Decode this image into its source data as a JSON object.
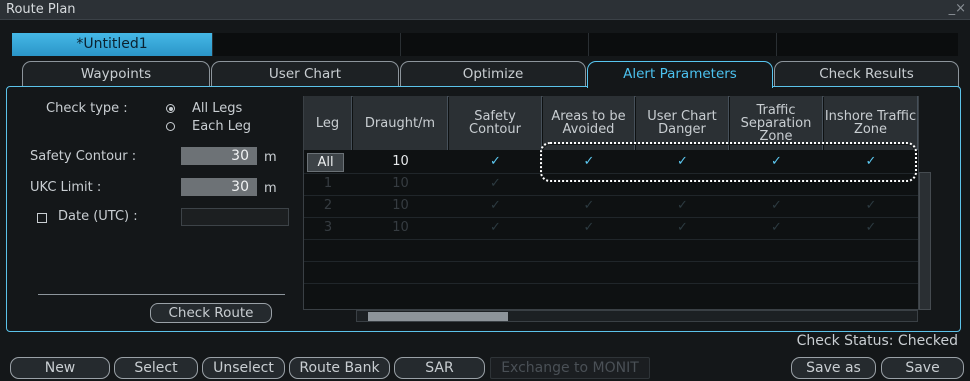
{
  "window": {
    "title": "Route Plan",
    "close": "_×"
  },
  "files": {
    "active": "*Untitled1"
  },
  "tabs": [
    "Waypoints",
    "User Chart",
    "Optimize",
    "Alert Parameters",
    "Check Results"
  ],
  "left": {
    "check_type_label": "Check type :",
    "options": [
      "All Legs",
      "Each Leg"
    ],
    "selected": "All Legs",
    "safety_contour_label": "Safety Contour :",
    "safety_contour_value": "30",
    "safety_contour_unit": "m",
    "ukc_label": "UKC Limit :",
    "ukc_value": "30",
    "ukc_unit": "m",
    "date_label": "Date (UTC) :",
    "check_route": "Check Route"
  },
  "table": {
    "headers": [
      "Leg",
      "Draught/m",
      "Safety Contour",
      "Areas to be Avoided",
      "User Chart Danger",
      "Traffic Separation Zone",
      "Inshore Traffic Zone"
    ],
    "rows": [
      {
        "leg": "All",
        "draught": "10",
        "checks": [
          "✓",
          "✓",
          "✓",
          "✓",
          "✓"
        ]
      },
      {
        "leg": "1",
        "draught": "10",
        "checks": [
          "✓",
          "",
          "",
          "",
          ""
        ]
      },
      {
        "leg": "2",
        "draught": "10",
        "checks": [
          "✓",
          "✓",
          "✓",
          "✓",
          "✓"
        ]
      },
      {
        "leg": "3",
        "draught": "10",
        "checks": [
          "✓",
          "✓",
          "✓",
          "✓",
          "✓"
        ]
      }
    ]
  },
  "status": "Check Status: Checked",
  "footer": {
    "new": "New",
    "select": "Select",
    "unselect": "Unselect",
    "route_bank": "Route Bank",
    "sar": "SAR",
    "exchange": "Exchange to MONIT",
    "save_as": "Save as",
    "save": "Save"
  },
  "colors": {
    "accent": "#4cc2ef",
    "highlight": "#ffffff"
  }
}
